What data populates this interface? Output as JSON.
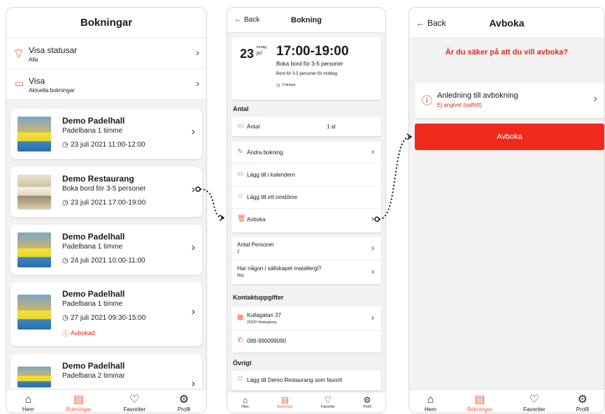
{
  "screen1": {
    "title": "Bokningar",
    "filter_status_label": "Visa statusar",
    "filter_status_value": "Alla",
    "filter_view_label": "Visa",
    "filter_view_value": "Aktuella bokningar",
    "cards": [
      {
        "title": "Demo Padelhall",
        "subtitle": "Padelbana 1 timme",
        "date": "23 juli 2021 11:00-12:00",
        "status": ""
      },
      {
        "title": "Demo Restaurang",
        "subtitle": "Boka bord för 3-5 personer",
        "date": "23 juli 2021 17:00-19:00",
        "status": ""
      },
      {
        "title": "Demo Padelhall",
        "subtitle": "Padelbana 1 timme",
        "date": "24 juli 2021 10:00-11:00",
        "status": ""
      },
      {
        "title": "Demo Padelhall",
        "subtitle": "Padelbana 1 timme",
        "date": "27 juli 2021 09:30-15:00",
        "status": "Avbokad"
      },
      {
        "title": "Demo Padelhall",
        "subtitle": "Padelbana 2 timmar",
        "date": "",
        "status": ""
      }
    ],
    "tabs": [
      {
        "label": "Hem",
        "icon": "home-icon"
      },
      {
        "label": "Bokningar",
        "icon": "calendar-icon"
      },
      {
        "label": "Favoriter",
        "icon": "heart-icon"
      },
      {
        "label": "Profil",
        "icon": "gear-icon"
      }
    ]
  },
  "screen2": {
    "back": "Back",
    "title": "Bokning",
    "day": "23",
    "weekday": "fredag",
    "month": "jul",
    "time": "17:00-19:00",
    "product": "Boka bord för 3-5 personer",
    "description": "Bord för 3-5 personer för middag.",
    "duration": "2 timmar",
    "section_antal": "Antal",
    "antal_label": "Antal",
    "antal_value": "1 st",
    "actions": [
      "Ändra bokning",
      "Lägg till i kalendern",
      "Lägg till ett omdöme",
      "Avboka"
    ],
    "q1_label": "Antal Personer",
    "q1_value": "2",
    "q2_label": "Har någon i sällskapet matallergi?",
    "q2_value": "Nej",
    "section_contact": "Kontaktuppgifter",
    "address": "Kullagatan 37",
    "postal": "25220 Helsingborg",
    "phone": "099-990099090",
    "section_other": "Övrigt",
    "favorite": "Lägg till Demo Restaurang som favorit",
    "tabs": [
      {
        "label": "Hem"
      },
      {
        "label": "Bokningar"
      },
      {
        "label": "Favoriter"
      },
      {
        "label": "Profil"
      }
    ]
  },
  "screen3": {
    "back": "Back",
    "title": "Avboka",
    "question": "Är du säker på att du vill avboka?",
    "reason_label": "Anledning till avbokning",
    "reason_value": "Ej angivet (valfritt)",
    "button": "Avboka",
    "tabs": [
      {
        "label": "Hem"
      },
      {
        "label": "Bokningar"
      },
      {
        "label": "Favoriter"
      },
      {
        "label": "Profil"
      }
    ]
  },
  "colors": {
    "accent": "#e96a3c",
    "danger": "#f0291c",
    "background": "#f2f2f2"
  }
}
